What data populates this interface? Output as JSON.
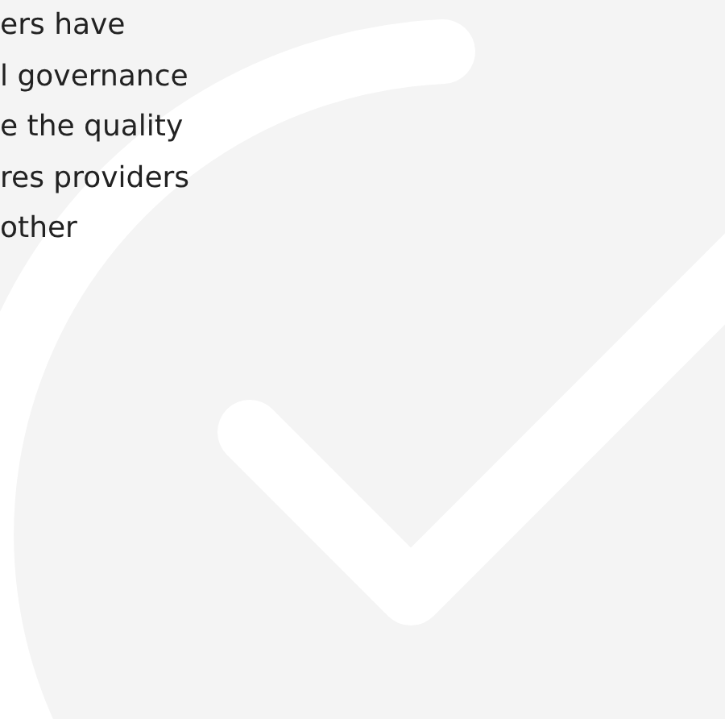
{
  "paragraph_lines": [
    "ers have",
    "l governance",
    "e the quality",
    "res providers",
    "other"
  ]
}
